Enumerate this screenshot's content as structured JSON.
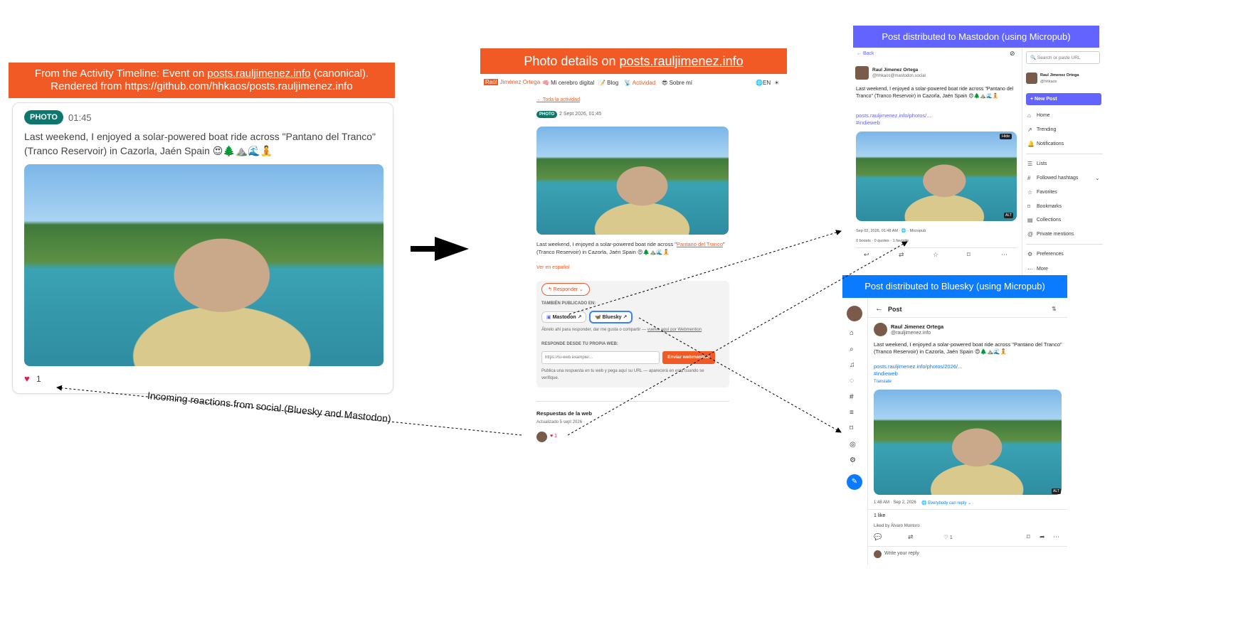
{
  "left_panel": {
    "banner_line1_prefix": "From the Activity Timeline: Event on ",
    "banner_link": "posts.rauljimenez.info",
    "banner_line1_suffix": " (canonical).",
    "banner_line2": "Rendered from https://github.com/hhkaos/posts.rauljimenez.info",
    "badge": "PHOTO",
    "time": "01:45",
    "text": "Last weekend, I enjoyed a solar-powered boat ride across \"Pantano del Tranco\" (Tranco Reservoir) in Cazorla, Jaén Spain 😍🌲⛰️🌊🧘",
    "like_count": "1"
  },
  "middle_panel": {
    "banner_prefix": "Photo details on ",
    "banner_link": "posts.rauljimenez.info",
    "brand_first": "Raúl",
    "brand_rest": " Jiménez Ortega",
    "nav": [
      "🧠 Mi cerebro digital",
      "📝 Blog",
      "📡 Actividad",
      "😎 Sobre mí"
    ],
    "lang": "EN",
    "back_link": "← Toda la actividad",
    "badge": "PHOTO",
    "date": "2 Sept 2026, 01:45",
    "text_before_link": "Last weekend, I enjoyed a solar-powered boat ride across \"",
    "text_link": "Pantano del Tranco",
    "text_after_link": "\" (Tranco Reservoir) in Cazorla, Jaén Spain 😍🌲⛰️🌊🧘",
    "translate_link": "Ver en español",
    "reply_button": "↰ Responder ⌄",
    "also_published": "TAMBIÉN PUBLICADO EN:",
    "chip_mastodon": "Mastodon ↗",
    "chip_bluesky": "Bluesky ↗",
    "open_hint_prefix": "Ábrelo ahí para responder, dar me gusta o compartir — ",
    "open_hint_link": "vuelve aquí por Webmention",
    "reply_from_web": "RESPONDE DESDE TU PROPIA WEB:",
    "url_placeholder": "https://tu-web.example/...",
    "send_button": "Enviar webmention",
    "publish_hint": "Publica una respuesta en tu web y pega aquí su URL — aparecerá en esta cuando se verifique.",
    "responses_title": "Respuestas de la web",
    "updated": "Actualizado 5 sept 2026",
    "likes": "♥ 1"
  },
  "arrow_label": "Incoming reactions from social (Bluesky and Mastodon)",
  "mastodon": {
    "banner": "Post distributed to Mastodon (using Micropub)",
    "back": "← Back",
    "search_placeholder": "Search or paste URL",
    "author": "Raul Jimenez Ortega",
    "handle": "@hhkaos@mastodon.social",
    "text": "Last weekend, I enjoyed a solar-powered boat ride across \"Pantano del Tranco\" (Tranco Reservoir) in Cazorla, Jaén Spain 😍🌲⛰️🌊🧘",
    "link": "posts.rauljimenez.info/photos/...",
    "hashtag": "#indieweb",
    "hide": "Hide",
    "alt": "ALT",
    "meta": "Sep 02, 2026, 01:48 AM · 🌐 · Micropub",
    "stats": "0 boosts · 0 quotes · 1 favorite",
    "side_author": "Raul Jimenez Ortega",
    "side_handle": "@hhkaos",
    "new_post": "+ New Post",
    "menu": [
      "Home",
      "Trending",
      "Notifications",
      "Lists",
      "Followed hashtags",
      "Favorites",
      "Bookmarks",
      "Collections",
      "Private mentions",
      "Preferences",
      "More"
    ]
  },
  "bluesky": {
    "banner": "Post distributed to Bluesky (using Micropub)",
    "header": "Post",
    "author": "Raul Jimenez Ortega",
    "handle": "@rauljimenez.info",
    "text": "Last weekend, I enjoyed a solar-powered boat ride across \"Pantano del Tranco\" (Tranco Reservoir) in Cazorla, Jaén Spain 😍🌲⛰️🌊🧘",
    "link": "posts.rauljimenez.info/photos/2026/...",
    "hashtag": "#indieweb",
    "translate": "Translate",
    "alt": "ALT",
    "meta": "1:48 AM · Sep 2, 2026",
    "reply_setting": "🌐 Everybody can reply ⌄",
    "likes_count": "1 like",
    "liked_by": "Liked by Álvaro Montoro",
    "like_action": "♡ 1",
    "write_reply": "Write your reply"
  },
  "colors": {
    "orange": "#f15a24",
    "mastodon_banner": "#6364ff",
    "bluesky_banner": "#0a7aff",
    "teal": "#0f766e"
  }
}
